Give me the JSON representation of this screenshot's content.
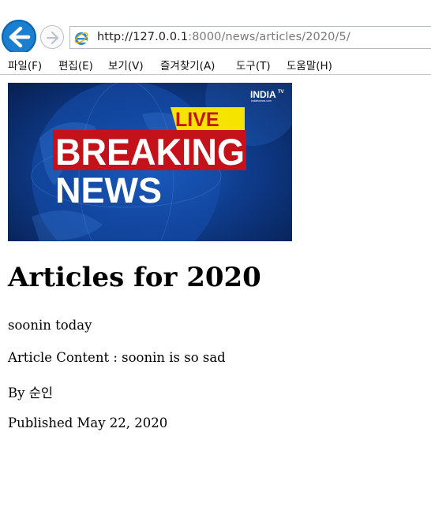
{
  "browser": {
    "url_host": "http://127.0.0.1",
    "url_rest": ":8000/news/articles/2020/5/",
    "menu": [
      "파일(F)",
      "편집(E)",
      "보기(V)",
      "즐겨찾기(A)",
      "도구(T)",
      "도움말(H)"
    ],
    "icons": {
      "back": "back-arrow-icon",
      "forward": "forward-arrow-icon",
      "site": "ie-logo-icon"
    },
    "colors": {
      "back_button": "#1a7fd1"
    }
  },
  "banner": {
    "live": "LIVE",
    "breaking": "BREAKING",
    "news": "NEWS",
    "brand": "INDIA",
    "brand_tv": "TV",
    "brand_site": "indiatvnews.com",
    "colors": {
      "live_bg": "#f4e400",
      "breaking_bg": "#c4121a",
      "globe": "#1e63c4"
    }
  },
  "article": {
    "title": "Articles for 2020",
    "headline": "soonin today",
    "content": "Article Content : soonin is so sad",
    "author": "By 순인",
    "published": "Published May 22, 2020"
  }
}
